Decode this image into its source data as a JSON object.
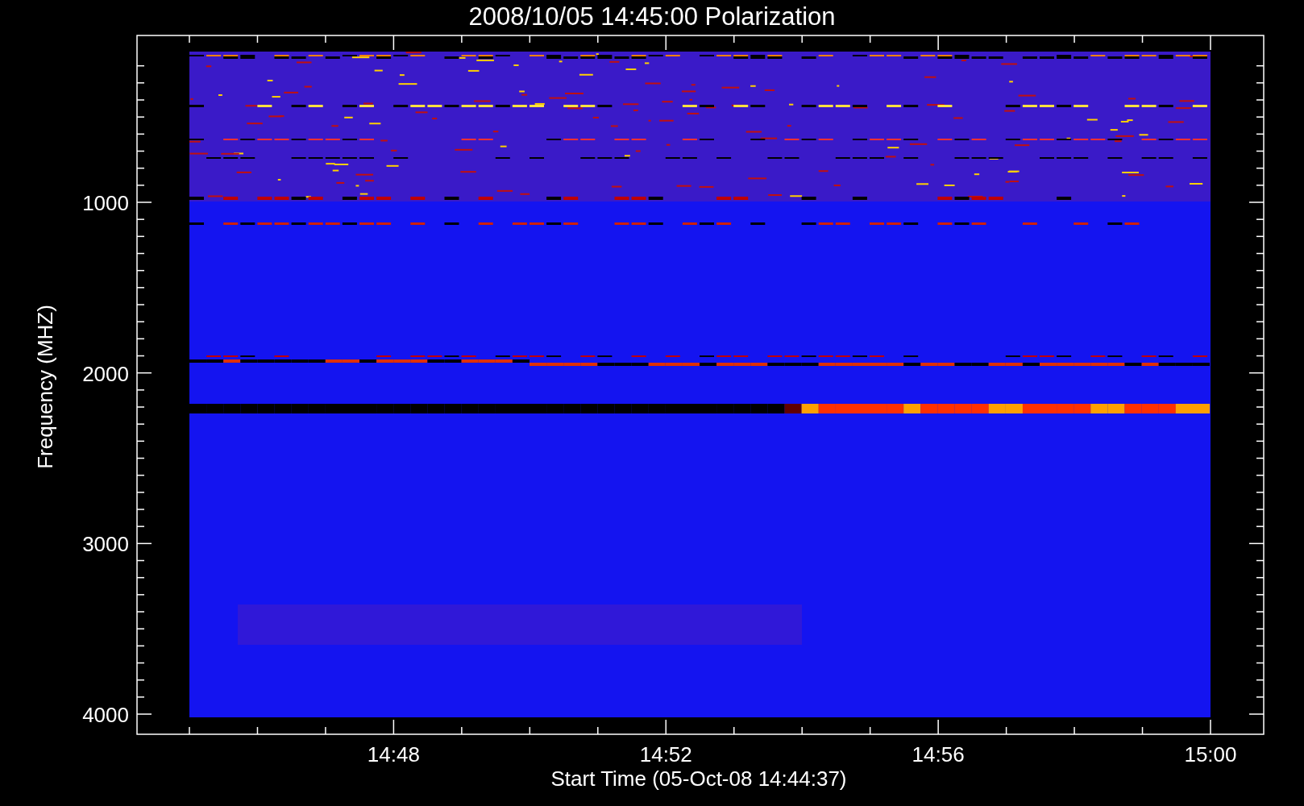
{
  "title": "2008/10/05 14:45:00 Polarization",
  "y_axis": {
    "label": "Frequency (MHZ)",
    "ticks": [
      "1000",
      "2000",
      "3000",
      "4000"
    ]
  },
  "x_axis": {
    "label": "Start Time (05-Oct-08 14:44:37)",
    "ticks": [
      "14:48",
      "14:52",
      "14:56",
      "15:00"
    ]
  }
}
